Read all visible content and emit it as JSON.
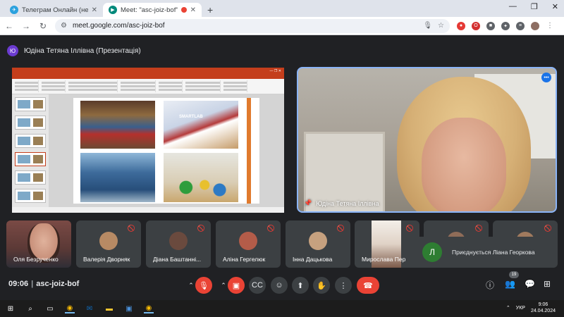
{
  "browser": {
    "tabs": [
      {
        "title": "Телеграм Онлайн (неофіційн",
        "close": "✕",
        "icon_color": "#2aa1de"
      },
      {
        "title": "Meet: \"asc-joiz-bof\"",
        "close": "✕",
        "icon_color": "#00897b",
        "active": true
      }
    ],
    "new_tab": "+",
    "window_controls": [
      "—",
      "❐",
      "✕"
    ],
    "address": "meet.google.com/asc-joiz-bof",
    "nav": {
      "back": "←",
      "forward": "→",
      "reload": "↻"
    }
  },
  "meet": {
    "presenter_initial": "Ю",
    "presenter_label": "Юдіна Тетяна Іллівна (Презентація)",
    "presentation": {
      "slide_text": "SMARTLAB"
    },
    "speaker": {
      "name": "Юдіна Тетяна Іллівна",
      "pin": "📌",
      "activity": "•••"
    },
    "participants": [
      {
        "name": "Оля Безрученко",
        "muted": false,
        "avatar_color": ""
      },
      {
        "name": "Валерія Дворняк",
        "muted": true,
        "avatar_color": "#b78a64"
      },
      {
        "name": "Діана Баштанні...",
        "muted": true,
        "avatar_color": "#6a4a3e"
      },
      {
        "name": "Аліна Гергелюк",
        "muted": true,
        "avatar_color": "#b35c49"
      },
      {
        "name": "Інна Дацькова",
        "muted": true,
        "avatar_color": "#c6a17f"
      },
      {
        "name": "Мирослава Пер",
        "muted": true,
        "avatar_color": "#e9dfd6"
      },
      {
        "name": "",
        "muted": true,
        "avatar_color": "#8f6c58"
      },
      {
        "name": "",
        "muted": true,
        "avatar_color": "#a07a5e"
      }
    ],
    "join_toast": {
      "initial": "Л",
      "message": "Приєднується Ліана Георкова"
    },
    "time": "09:06",
    "meeting_code": "asc-joiz-bof",
    "participant_count": "19"
  },
  "taskbar": {
    "lang": "УКР",
    "time": "9:06",
    "date": "24.04.2024"
  }
}
